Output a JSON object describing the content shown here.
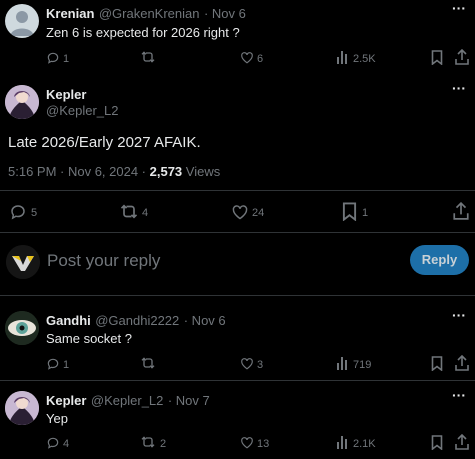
{
  "tweets": [
    {
      "name": "Krenian",
      "handle": "@GrakenKrenian",
      "date": "· Nov 6",
      "text": "Zen 6 is expected for 2026 right ?",
      "replies": "1",
      "retweets": "",
      "likes": "6",
      "views": "2.5K"
    },
    {
      "name": "Gandhi",
      "handle": "@Gandhi2222",
      "date": "· Nov 6",
      "text": "Same socket ?",
      "replies": "1",
      "retweets": "",
      "likes": "3",
      "views": "719"
    },
    {
      "name": "Kepler",
      "handle": "@Kepler_L2",
      "date": "· Nov 7",
      "text": "Yep",
      "replies": "4",
      "retweets": "2",
      "likes": "13",
      "views": "2.1K"
    }
  ],
  "main": {
    "name": "Kepler",
    "handle": "@Kepler_L2",
    "text": "Late 2026/Early 2027 AFAIK.",
    "time": "5:16 PM · Nov 6, 2024 · ",
    "views_count": "2,573",
    "views_label": " Views",
    "replies": "5",
    "retweets": "4",
    "likes": "24",
    "bookmarks": "1"
  },
  "compose": {
    "placeholder": "Post your reply",
    "button": "Reply"
  },
  "colors": {
    "background": "#000000",
    "text": "#e7e9ea",
    "muted": "#71767b",
    "reply_button": "#1d9bf0"
  }
}
